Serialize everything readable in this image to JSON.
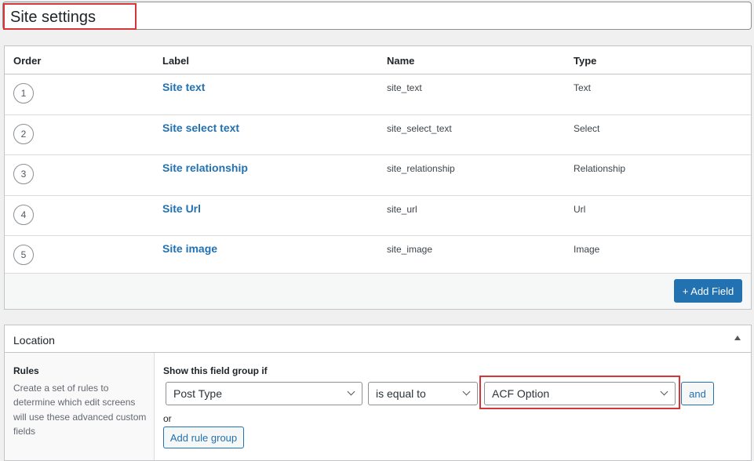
{
  "title": {
    "value": "Site settings"
  },
  "fields": {
    "headers": {
      "order": "Order",
      "label": "Label",
      "name": "Name",
      "type": "Type"
    },
    "rows": [
      {
        "order": "1",
        "label": "Site text",
        "name": "site_text",
        "type": "Text"
      },
      {
        "order": "2",
        "label": "Site select text",
        "name": "site_select_text",
        "type": "Select"
      },
      {
        "order": "3",
        "label": "Site relationship",
        "name": "site_relationship",
        "type": "Relationship"
      },
      {
        "order": "4",
        "label": "Site Url",
        "name": "site_url",
        "type": "Url"
      },
      {
        "order": "5",
        "label": "Site image",
        "name": "site_image",
        "type": "Image"
      }
    ],
    "add_field_label": "+ Add Field"
  },
  "location": {
    "title": "Location",
    "rules_title": "Rules",
    "rules_desc": "Create a set of rules to determine which edit screens will use these advanced custom fields",
    "show_if": "Show this field group if",
    "param": "Post Type",
    "operator": "is equal to",
    "value": "ACF Option",
    "and_label": "and",
    "or_label": "or",
    "add_rule_group_label": "Add rule group"
  },
  "colors": {
    "accent": "#2271b1",
    "highlight": "#d63638"
  }
}
